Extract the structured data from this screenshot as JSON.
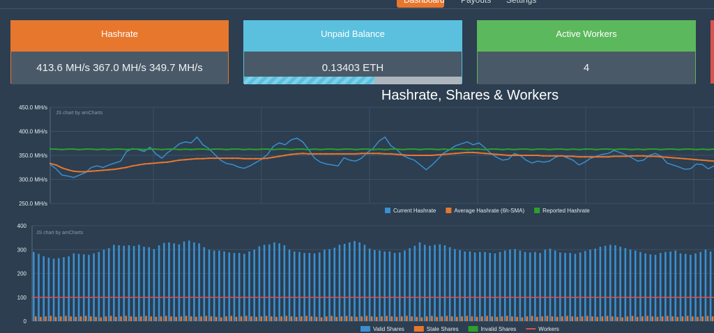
{
  "nav": {
    "tabs": [
      {
        "label": "Dashboard"
      },
      {
        "label": "Payouts"
      },
      {
        "label": "Settings"
      }
    ]
  },
  "cards": {
    "hashrate": {
      "title": "Hashrate",
      "value": "413.6 MH/s 367.0 MH/s 349.7 MH/s"
    },
    "balance": {
      "title": "Unpaid Balance",
      "value": "0.13403 ETH",
      "progress": 0.6
    },
    "workers": {
      "title": "Active Workers",
      "value": "4"
    }
  },
  "colors": {
    "orange": "#e8772e",
    "blue": "#3a8fd0",
    "green": "#2ca02c",
    "cyan": "#5bc0de",
    "red": "#d9534f"
  },
  "chart_data": [
    {
      "type": "line",
      "title": "Hashrate, Shares & Workers",
      "watermark": "JS chart by amCharts",
      "ylim": [
        250,
        450
      ],
      "yticks": [
        "450.0 MH/s",
        "400.0 MH/s",
        "350.0 MH/s",
        "300.0 MH/s",
        "250.0 MH/s"
      ],
      "legend": [
        "Current Hashrate",
        "Average Hashrate (6h-SMA)",
        "Reported Hashrate"
      ],
      "legend_position": "bottom",
      "series": [
        {
          "name": "Current Hashrate",
          "color": "#3a8fd0",
          "values": [
            331,
            322,
            309,
            307,
            304,
            309,
            314,
            325,
            328,
            325,
            330,
            334,
            338,
            358,
            364,
            362,
            358,
            367,
            353,
            344,
            356,
            364,
            374,
            378,
            376,
            388,
            372,
            364,
            352,
            340,
            333,
            331,
            326,
            323,
            328,
            335,
            342,
            352,
            369,
            376,
            372,
            382,
            386,
            378,
            362,
            344,
            336,
            332,
            330,
            328,
            345,
            340,
            338,
            344,
            356,
            365,
            380,
            388,
            370,
            362,
            350,
            344,
            340,
            330,
            320,
            330,
            342,
            355,
            362,
            370,
            374,
            378,
            372,
            376,
            366,
            354,
            346,
            340,
            342,
            354,
            350,
            340,
            334,
            338,
            336,
            338,
            346,
            350,
            345,
            340,
            330,
            336,
            344,
            348,
            352,
            354,
            360,
            356,
            351,
            345,
            338,
            340,
            350,
            354,
            348,
            334,
            330,
            326,
            321,
            322,
            332,
            331,
            322,
            328
          ]
        },
        {
          "name": "Average Hashrate (6h-SMA)",
          "color": "#e8772e",
          "values": [
            333,
            330,
            324,
            320,
            317,
            316,
            316,
            317,
            318,
            319,
            320,
            321,
            323,
            325,
            328,
            330,
            332,
            333,
            334,
            335,
            336,
            338,
            340,
            341,
            342,
            343,
            343,
            344,
            344,
            344,
            344,
            344,
            344,
            343,
            343,
            343,
            343,
            344,
            346,
            348,
            350,
            352,
            353,
            354,
            353,
            353,
            353,
            353,
            353,
            353,
            353,
            353,
            353,
            354,
            354,
            354,
            354,
            353,
            353,
            352,
            351,
            350,
            350,
            350,
            350,
            350,
            351,
            352,
            353,
            354,
            355,
            356,
            356,
            355,
            354,
            353,
            352,
            351,
            350,
            350,
            350,
            350,
            350,
            350,
            349,
            349,
            349,
            349,
            348,
            348,
            347,
            347,
            347,
            347,
            347,
            347,
            348,
            348,
            348,
            349,
            349,
            349,
            348,
            348,
            347,
            346,
            345,
            344,
            343,
            342,
            341,
            340,
            339,
            338
          ]
        },
        {
          "name": "Reported Hashrate",
          "color": "#2ca02c",
          "values": [
            363,
            363,
            362,
            363,
            363,
            362,
            363,
            363,
            362,
            363,
            362,
            363,
            363,
            362,
            363,
            363,
            362,
            363,
            363,
            362,
            363,
            363,
            362,
            363,
            362,
            363,
            363,
            362,
            363,
            363,
            362,
            363,
            363,
            362,
            363,
            362,
            363,
            363,
            362,
            363,
            363,
            362,
            363,
            363,
            362,
            363,
            362,
            363,
            363,
            362,
            363,
            363,
            362,
            363,
            363,
            362,
            363,
            362,
            363,
            363,
            362,
            363,
            363,
            362,
            363,
            363,
            362,
            363,
            362,
            363,
            363,
            362,
            363,
            363,
            362,
            363,
            363,
            362,
            363,
            362,
            363,
            363,
            362,
            363,
            363,
            362,
            363,
            363,
            362,
            363,
            362,
            363,
            363,
            362,
            363,
            363,
            362,
            363,
            363,
            362,
            363,
            362,
            363,
            363,
            362,
            363,
            363,
            362,
            363,
            363,
            362,
            363,
            362,
            363
          ]
        }
      ]
    },
    {
      "type": "bar",
      "watermark": "JS chart by amCharts",
      "ylim": [
        0,
        400
      ],
      "yticks": [
        "400",
        "300",
        "200",
        "100",
        "0"
      ],
      "legend": [
        "Valid Shares",
        "Stale Shares",
        "Invalid Shares",
        "Workers"
      ],
      "legend_position": "bottom",
      "series": [
        {
          "name": "Valid Shares",
          "color": "#3a8fd0",
          "values": [
            290,
            282,
            272,
            266,
            262,
            264,
            268,
            272,
            284,
            282,
            280,
            278,
            284,
            290,
            300,
            306,
            320,
            318,
            316,
            318,
            315,
            320,
            312,
            310,
            302,
            318,
            328,
            330,
            326,
            322,
            334,
            338,
            330,
            326,
            310,
            300,
            296,
            296,
            292,
            288,
            286,
            286,
            282,
            292,
            300,
            314,
            320,
            322,
            330,
            326,
            318,
            300,
            292,
            290,
            286,
            286,
            284,
            288,
            300,
            302,
            308,
            320,
            324,
            330,
            336,
            330,
            320,
            304,
            298,
            296,
            292,
            292,
            286,
            288,
            296,
            306,
            316,
            330,
            320,
            316,
            320,
            322,
            318,
            310,
            302,
            298,
            292,
            292,
            288,
            290,
            290,
            286,
            284,
            290,
            296,
            300,
            302,
            296,
            290,
            288,
            290,
            286,
            300,
            304,
            296,
            288,
            286,
            286,
            282,
            288,
            294,
            300,
            304,
            312,
            316,
            320,
            318,
            312,
            306,
            300,
            296,
            290,
            284,
            280,
            278,
            286,
            290,
            292,
            296,
            284,
            282,
            278,
            284,
            290,
            300,
            292
          ]
        },
        {
          "name": "Stale Shares",
          "color": "#e8772e",
          "values": [
            20,
            18,
            20,
            22,
            18,
            20,
            22,
            20,
            18,
            20,
            22,
            20,
            18,
            16,
            20,
            22,
            18,
            20,
            22,
            20,
            18,
            20,
            22,
            20,
            18,
            20,
            22,
            20,
            18,
            20,
            22,
            20,
            18,
            20,
            22,
            20,
            18,
            16,
            20,
            22,
            18,
            20,
            22,
            20,
            18,
            20,
            22,
            20,
            18,
            20,
            22,
            20,
            18,
            20,
            22,
            20,
            18,
            16,
            20,
            22,
            18,
            20,
            22,
            20,
            18,
            20,
            22,
            20,
            18,
            20,
            22,
            20,
            18,
            20,
            22,
            20,
            18,
            16,
            20,
            22,
            18,
            20,
            22,
            20,
            18,
            20,
            22,
            20,
            18,
            20,
            22,
            20,
            18,
            20,
            22,
            20,
            18,
            16,
            20,
            22,
            18,
            20,
            22,
            20,
            18,
            20,
            22,
            20,
            18,
            20,
            22,
            20,
            18,
            20,
            22,
            20,
            18,
            16,
            20,
            22,
            18,
            20,
            22,
            20,
            18,
            20,
            22,
            20,
            18,
            20,
            22,
            20,
            18,
            20,
            22,
            20
          ]
        },
        {
          "name": "Invalid Shares",
          "color": "#2ca02c",
          "values": [
            0
          ]
        },
        {
          "name": "Workers",
          "color": "#d9534f",
          "values": [
            100
          ]
        }
      ]
    }
  ]
}
